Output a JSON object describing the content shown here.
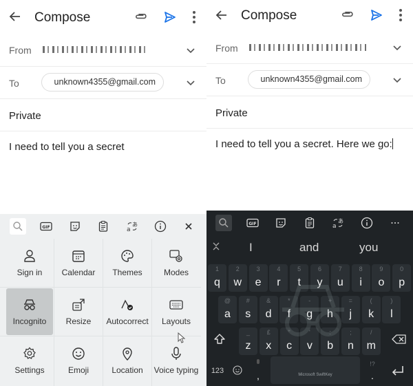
{
  "left": {
    "appbar": {
      "title": "Compose",
      "back_icon": "arrow-left-icon",
      "attach_icon": "paperclip-icon",
      "send_icon": "send-icon",
      "more_icon": "more-vertical-icon"
    },
    "from": {
      "label": "From",
      "value_redacted": true
    },
    "to": {
      "label": "To",
      "recipient": "unknown4355@gmail.com"
    },
    "subject": "Private",
    "body": "I need to tell you a secret",
    "keyboard": {
      "theme": "light",
      "toolbar": [
        "search-icon",
        "gif-icon",
        "sticker-icon",
        "clipboard-icon",
        "translate-icon",
        "info-icon",
        "close-icon"
      ],
      "grid": [
        {
          "label": "Sign in",
          "icon": "person-icon"
        },
        {
          "label": "Calendar",
          "icon": "calendar-icon"
        },
        {
          "label": "Themes",
          "icon": "palette-icon"
        },
        {
          "label": "Modes",
          "icon": "keyboard-settings-icon"
        },
        {
          "label": "Incognito",
          "icon": "incognito-icon",
          "active": true
        },
        {
          "label": "Resize",
          "icon": "resize-icon"
        },
        {
          "label": "Autocorrect",
          "icon": "autocorrect-icon"
        },
        {
          "label": "Layouts",
          "icon": "keyboard-icon"
        },
        {
          "label": "Settings",
          "icon": "gear-icon"
        },
        {
          "label": "Emoji",
          "icon": "smiley-icon"
        },
        {
          "label": "Location",
          "icon": "location-pin-icon"
        },
        {
          "label": "Voice typing",
          "icon": "microphone-icon"
        }
      ]
    }
  },
  "right": {
    "appbar": {
      "title": "Compose",
      "back_icon": "arrow-left-icon",
      "attach_icon": "paperclip-icon",
      "send_icon": "send-icon",
      "more_icon": "more-vertical-icon"
    },
    "from": {
      "label": "From",
      "value_redacted": true
    },
    "to": {
      "label": "To",
      "recipient": "unknown4355@gmail.com"
    },
    "subject": "Private",
    "body": "I need to tell you a secret. Here we go:",
    "keyboard": {
      "theme": "dark",
      "toolbar": [
        "search-icon",
        "gif-icon",
        "sticker-icon",
        "clipboard-icon",
        "translate-icon",
        "info-icon",
        "more-horizontal-icon"
      ],
      "suggestions": [
        "I",
        "and",
        "you"
      ],
      "rows": [
        [
          {
            "k": "q",
            "s": "1"
          },
          {
            "k": "w",
            "s": "2"
          },
          {
            "k": "e",
            "s": "3"
          },
          {
            "k": "r",
            "s": "4"
          },
          {
            "k": "t",
            "s": "5"
          },
          {
            "k": "y",
            "s": "6"
          },
          {
            "k": "u",
            "s": "7"
          },
          {
            "k": "i",
            "s": "8"
          },
          {
            "k": "o",
            "s": "9"
          },
          {
            "k": "p",
            "s": "0"
          }
        ],
        [
          {
            "k": "a",
            "s": "@"
          },
          {
            "k": "s",
            "s": "#"
          },
          {
            "k": "d",
            "s": "&"
          },
          {
            "k": "f",
            "s": "*"
          },
          {
            "k": "g",
            "s": "-"
          },
          {
            "k": "h",
            "s": "+"
          },
          {
            "k": "j",
            "s": "="
          },
          {
            "k": "k",
            "s": "("
          },
          {
            "k": "l",
            "s": ")"
          }
        ],
        [
          {
            "k": "z",
            "s": "_"
          },
          {
            "k": "x",
            "s": "£"
          },
          {
            "k": "c",
            "s": "\""
          },
          {
            "k": "v",
            "s": "'"
          },
          {
            "k": "b",
            "s": ":"
          },
          {
            "k": "n",
            "s": ";"
          },
          {
            "k": "m",
            "s": "/"
          }
        ]
      ],
      "bottom": {
        "numbers": "123",
        "comma": ",",
        "period": ".",
        "period_sec": "!?",
        "space_brand": "Microsoft SwiftKey"
      }
    }
  }
}
